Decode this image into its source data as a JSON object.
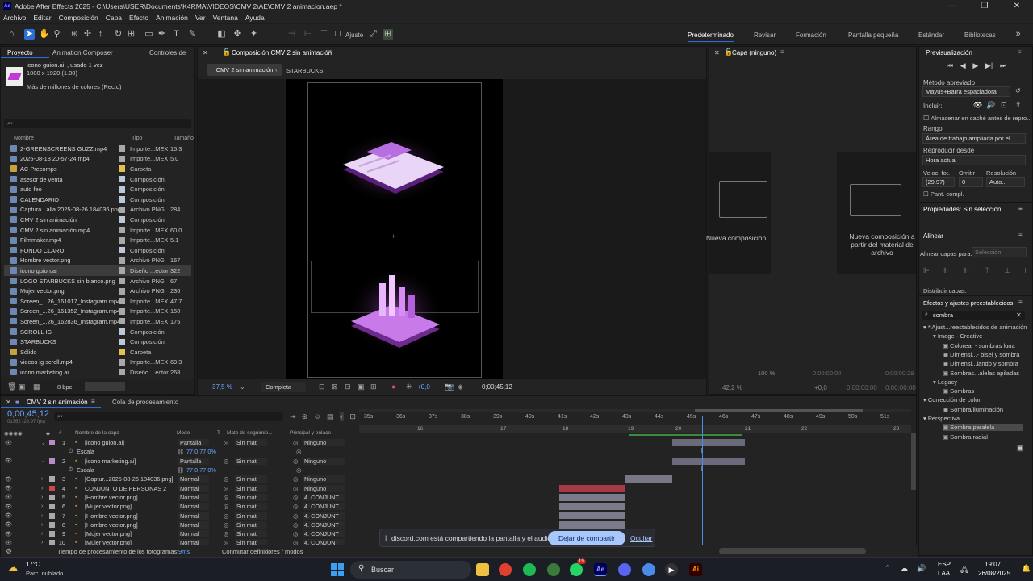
{
  "window": {
    "title": "Adobe After Effects 2025 - C:\\Users\\USER\\Documents\\K4RMA\\VIDEOS\\CMV 2\\AE\\CMV 2 animacion.aep *",
    "minimize": "—",
    "maximize": "❐",
    "close": "✕"
  },
  "menu": [
    "Archivo",
    "Editar",
    "Composición",
    "Capa",
    "Efecto",
    "Animación",
    "Ver",
    "Ventana",
    "Ayuda"
  ],
  "toolbar": {
    "ajuste": "Ajuste",
    "workspaces": [
      "Predeterminado",
      "Revisar",
      "Formación",
      "Pantalla pequeña",
      "Estándar",
      "Bibliotecas"
    ]
  },
  "project": {
    "tabs": [
      "Proyecto",
      "Animation Composer",
      "Controles de"
    ],
    "selected_name": "icono guion.ai",
    "selected_info1": ", usado 1 vez",
    "selected_info2": "1080 x 1920 (1.00)",
    "selected_info3": "Más de millones de colores (Recto)",
    "search_placeholder": "⌕▾",
    "columns": {
      "name": "Nombre",
      "type": "Tipo",
      "size": "Tamaño"
    },
    "bpc": "8 bpc",
    "items": [
      {
        "name": "2-GREENSCREENS GUZZ.mp4",
        "type": "Importe...MEX",
        "size": "15.3",
        "label": "#a9a9a9"
      },
      {
        "name": "2025-08-18 20-57-24.mp4",
        "type": "Importe...MEX",
        "size": "5.0",
        "label": "#a9a9a9"
      },
      {
        "name": "AC Precomps",
        "type": "Carpeta",
        "size": "",
        "label": "#e3c14a"
      },
      {
        "name": "asesor de venta",
        "type": "Composición",
        "size": "",
        "label": "#bcc7d8"
      },
      {
        "name": "auto feo",
        "type": "Composición",
        "size": "",
        "label": "#bcc7d8"
      },
      {
        "name": "CALENDARIO",
        "type": "Composición",
        "size": "",
        "label": "#bcc7d8"
      },
      {
        "name": "Captura...alla 2025-08-26 184036.png",
        "type": "Archivo PNG",
        "size": "284",
        "label": "#a9a9a9"
      },
      {
        "name": "CMV 2 sin animación",
        "type": "Composición",
        "size": "",
        "label": "#bcc7d8"
      },
      {
        "name": "CMV 2 sin animación.mp4",
        "type": "Importe...MEX",
        "size": "60.0",
        "label": "#a9a9a9"
      },
      {
        "name": "Filmmaker.mp4",
        "type": "Importe...MEX",
        "size": "5.1",
        "label": "#a9a9a9"
      },
      {
        "name": "FONDO CLARO",
        "type": "Composición",
        "size": "",
        "label": "#bcc7d8"
      },
      {
        "name": "Hombre vector.png",
        "type": "Archivo PNG",
        "size": "167",
        "label": "#a9a9a9"
      },
      {
        "name": "icono guion.ai",
        "type": "Diseño ...ector",
        "size": "322",
        "label": "#a9a9a9"
      },
      {
        "name": "LOGO STARBUCKS sin blanco.png",
        "type": "Archivo PNG",
        "size": "67",
        "label": "#a9a9a9"
      },
      {
        "name": "Mujer vector.png",
        "type": "Archivo PNG",
        "size": "236",
        "label": "#a9a9a9"
      },
      {
        "name": "Screen_...26_161017_Instagram.mp4",
        "type": "Importe...MEX",
        "size": "47.7",
        "label": "#a9a9a9"
      },
      {
        "name": "Screen_...26_161352_Instagram.mp4",
        "type": "Importe...MEX",
        "size": "150",
        "label": "#a9a9a9"
      },
      {
        "name": "Screen_...26_162836_Instagram.mp4",
        "type": "Importe...MEX",
        "size": "175",
        "label": "#a9a9a9"
      },
      {
        "name": "SCROLL IG",
        "type": "Composición",
        "size": "",
        "label": "#bcc7d8"
      },
      {
        "name": "STARBUCKS",
        "type": "Composición",
        "size": "",
        "label": "#bcc7d8"
      },
      {
        "name": "Sólido",
        "type": "Carpeta",
        "size": "",
        "label": "#e3c14a"
      },
      {
        "name": "videos ig scroll.mp4",
        "type": "Importe...MEX",
        "size": "69.3",
        "label": "#a9a9a9"
      },
      {
        "name": "icono marketing.ai",
        "type": "Diseño ...ector",
        "size": "268",
        "label": "#a9a9a9"
      }
    ]
  },
  "comp": {
    "panel_title": "Composición CMV 2 sin animación",
    "tab1": "CMV 2 sin animación",
    "tab2": "STARBUCKS",
    "zoom": "37,5 %",
    "resolution": "Completa",
    "exposure": "+0,0",
    "timecode": "0;00;45;12"
  },
  "layer_panel": {
    "title": "Capa (ninguno)",
    "new_comp": "Nueva composición",
    "new_comp_from": "Nueva composición a partir del material de archivo",
    "zoom": "42,2 %",
    "exposure": "+0,0",
    "zoom2": "100 %",
    "tc1": "0:00:00:00",
    "tc2": "0:00:00:29"
  },
  "timeline": {
    "tab1": "CMV 2 sin animación",
    "tab2": "Cola de procesamiento",
    "timecode": "0;00;45;12",
    "fps": "01362 (29.97 fps)",
    "search_placeholder": "⌕▾",
    "headers": {
      "num": "#",
      "name": "Nombre de la capa",
      "mode": "Modo",
      "t": "T",
      "mate": "Mate de seguimie...",
      "parent": "Principal y enlace"
    },
    "ruler": [
      "35s",
      "36s",
      "37s",
      "38s",
      "39s",
      "40s",
      "41s",
      "42s",
      "43s",
      "44s",
      "45s",
      "46s",
      "47s",
      "48s",
      "49s",
      "50s",
      "51s"
    ],
    "markers": [
      "16",
      "17",
      "18",
      "19",
      "20",
      "21",
      "22",
      "23"
    ],
    "layers": [
      {
        "num": "1",
        "name": "[icono guion.ai]",
        "mode": "Pantalla",
        "mate": "Sin mat",
        "parent": "Ninguno",
        "label": "#b98cc9"
      },
      {
        "num": "",
        "name": "Escala",
        "value": "77,0,77,0%",
        "prop": true
      },
      {
        "num": "2",
        "name": "[icono marketing.ai]",
        "mode": "Pantalla",
        "mate": "Sin mat",
        "parent": "Ninguno",
        "label": "#b98cc9"
      },
      {
        "num": "",
        "name": "Escala",
        "value": "77,0,77,0%",
        "prop": true
      },
      {
        "num": "3",
        "name": "[Captur...2025-08-26 184036.png]",
        "mode": "Normal",
        "mate": "Sin mat",
        "parent": "Ninguno",
        "label": "#a9a9a9"
      },
      {
        "num": "4",
        "name": "CONJUNTO DE PERSONAS 2",
        "mode": "Normal",
        "mate": "Sin mat",
        "parent": "Ninguno",
        "label": "#c94a4a"
      },
      {
        "num": "5",
        "name": "[Hombre vector.png]",
        "mode": "Normal",
        "mate": "Sin mat",
        "parent": "4. CONJUNT",
        "label": "#a9a9a9"
      },
      {
        "num": "6",
        "name": "[Mujer vector.png]",
        "mode": "Normal",
        "mate": "Sin mat",
        "parent": "4. CONJUNT",
        "label": "#a9a9a9"
      },
      {
        "num": "7",
        "name": "[Hombre vector.png]",
        "mode": "Normal",
        "mate": "Sin mat",
        "parent": "4. CONJUNT",
        "label": "#a9a9a9"
      },
      {
        "num": "8",
        "name": "[Hombre vector.png]",
        "mode": "Normal",
        "mate": "Sin mat",
        "parent": "4. CONJUNT",
        "label": "#a9a9a9"
      },
      {
        "num": "9",
        "name": "[Mujer vector.png]",
        "mode": "Normal",
        "mate": "Sin mat",
        "parent": "4. CONJUNT",
        "label": "#a9a9a9"
      },
      {
        "num": "10",
        "name": "[Mujer vector.png]",
        "mode": "Normal",
        "mate": "Sin mat",
        "parent": "4. CONJUNT",
        "label": "#a9a9a9"
      }
    ],
    "footer_left": "Tiempo de procesamiento de los fotogramas:",
    "footer_ms": "9ms",
    "footer_right": "Conmutar definidores / modos"
  },
  "notice": {
    "text": "discord.com está compartiendo la pantalla y el audio.",
    "stop": "Dejar de compartir",
    "hide": "Ocultar"
  },
  "right": {
    "preview_title": "Previsualización",
    "metodo": "Método abreviado",
    "metodo_val": "Mayús+Barra espaciadora",
    "incluir": "Incluir:",
    "cache": "Almacenar en caché antes de repro...",
    "rango": "Rango",
    "rango_val": "Área de trabajo ampliada por el...",
    "reproducir": "Reproducir desde",
    "reproducir_val": "Hora actual",
    "veloc": "Veloc. fot.",
    "omitir": "Omitir",
    "resolucion": "Resolución",
    "fps_val": "(29.97)",
    "omitir_val": "0",
    "res_val": "Auto...",
    "pant": "Pant. compl.",
    "props": "Propiedades: Sin selección",
    "alinear": "Alinear",
    "alinear_capas": "Alinear capas para:",
    "seleccion": "Selección",
    "distribuir": "Distribuir capas:",
    "efectos": "Efectos y ajustes preestablecidos",
    "search_val": "sombra",
    "tree": [
      {
        "t": "▾ * Ajust...reestablecidos de animación",
        "d": 0
      },
      {
        "t": "▾ Image - Creative",
        "d": 1
      },
      {
        "t": "Colorear - sombras luna",
        "d": 2
      },
      {
        "t": "Dimensi...- bisel y sombra",
        "d": 2
      },
      {
        "t": "Dimensi...lando y sombra",
        "d": 2
      },
      {
        "t": "Sombras...alelas apiladas",
        "d": 2
      },
      {
        "t": "▾ Legacy",
        "d": 1
      },
      {
        "t": "Sombras",
        "d": 2
      },
      {
        "t": "▾ Corrección de color",
        "d": 0
      },
      {
        "t": "Sombra/iluminación",
        "d": 2
      },
      {
        "t": "▾ Perspectiva",
        "d": 0
      },
      {
        "t": "Sombra paralela",
        "d": 2,
        "sel": true
      },
      {
        "t": "Sombra radial",
        "d": 2
      }
    ]
  },
  "taskbar": {
    "temp": "17°C",
    "weather": "Parc. nublado",
    "search": "Buscar",
    "lang": "ESP",
    "lang2": "LAA",
    "time": "19:07",
    "date": "26/08/2025",
    "badge": "19"
  }
}
